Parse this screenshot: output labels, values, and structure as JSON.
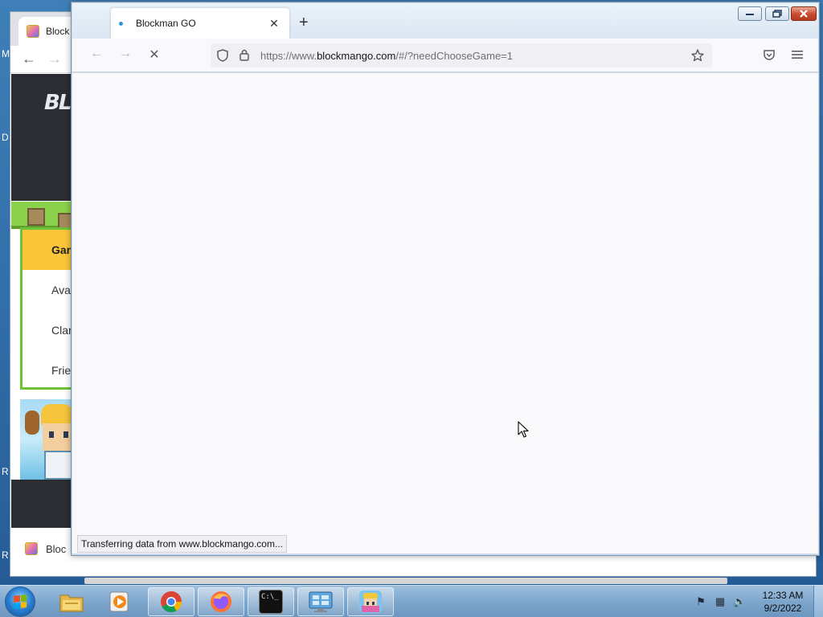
{
  "desktop": {
    "letters": [
      "M",
      "D",
      "R",
      "R"
    ]
  },
  "background_window": {
    "tab_title": "Block",
    "header_logo": "BL",
    "menu_items": [
      {
        "label": "Gar",
        "active": true
      },
      {
        "label": "Ava",
        "active": false
      },
      {
        "label": "Clar",
        "active": false
      },
      {
        "label": "Frie",
        "active": false
      }
    ],
    "bottom_label": "Bloc"
  },
  "firefox": {
    "tab": {
      "title": "Blockman GO",
      "close_glyph": "✕"
    },
    "new_tab_glyph": "+",
    "window_controls": {
      "minimize": "▭",
      "maximize": "⧉",
      "close": "✕"
    },
    "toolbar": {
      "back_glyph": "←",
      "forward_glyph": "→",
      "stop_glyph": "✕",
      "shield_glyph": "⛉",
      "lock_glyph": "🔒",
      "bookmark_glyph": "☆",
      "pocket_glyph": "◫",
      "menu_glyph": "≡"
    },
    "url": {
      "prefix": "https://www.",
      "domain": "blockmango.com",
      "suffix": "/#/?needChooseGame=1"
    },
    "status_text": "Transferring data from www.blockmango.com..."
  },
  "taskbar": {
    "pinned": [
      {
        "name": "windows-explorer",
        "open": false
      },
      {
        "name": "media-player",
        "open": false
      },
      {
        "name": "chrome",
        "open": true
      },
      {
        "name": "firefox",
        "open": true
      },
      {
        "name": "command-prompt",
        "open": true
      },
      {
        "name": "control-panel",
        "open": true
      },
      {
        "name": "blockman-go",
        "open": true
      }
    ],
    "cmd_label": "C:\\_",
    "clock": {
      "time": "12:33 AM",
      "date": "9/2/2022"
    }
  },
  "colors": {
    "chrome_menu_active": "#fcc63a",
    "grass": "#8bd14b",
    "firefox_content": "#f9f9fb",
    "taskbar": "#7ea6cc"
  }
}
